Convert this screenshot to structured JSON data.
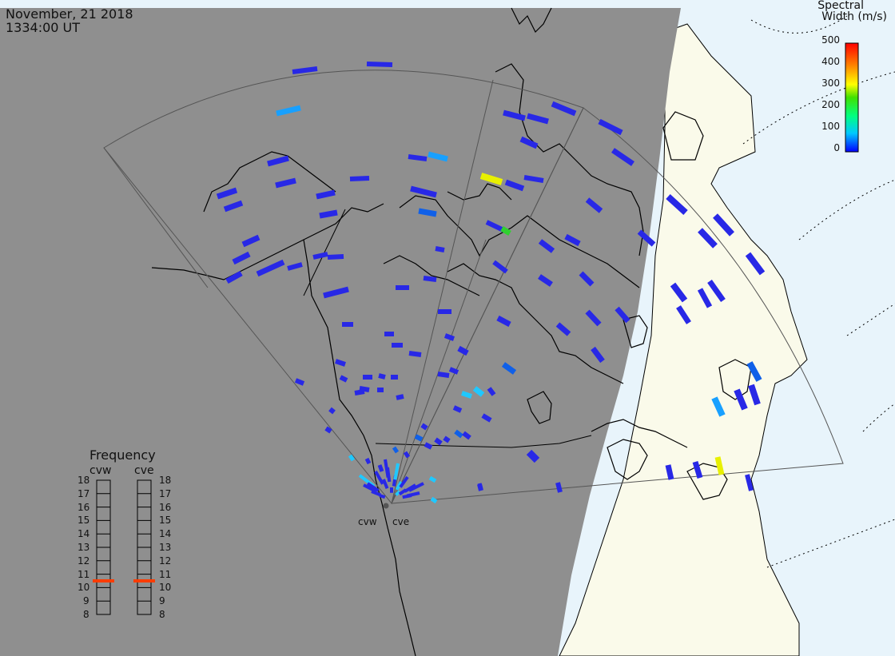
{
  "header": {
    "date": "November, 21 2018",
    "time": "1334:00 UT"
  },
  "colorbar": {
    "title_line1": "Spectral",
    "title_line2": "Width (m/s)",
    "ticks": [
      "500",
      "400",
      "300",
      "200",
      "100",
      "0"
    ],
    "colors": [
      "#ff0000",
      "#ff8000",
      "#ffff00",
      "#00d000",
      "#00c8ff",
      "#0000ff"
    ]
  },
  "frequency_panel": {
    "title": "Frequency",
    "radars": [
      {
        "name": "cvw",
        "value_mhz": 10.5
      },
      {
        "name": "cve",
        "value_mhz": 10.5
      }
    ],
    "scale": [
      "18",
      "17",
      "16",
      "15",
      "14",
      "13",
      "12",
      "11",
      "10",
      "9",
      "8"
    ]
  },
  "sites": [
    {
      "name": "cvw"
    },
    {
      "name": "cve"
    }
  ],
  "colors": {
    "night": "#8f8f8f",
    "day_land": "#fafaea",
    "day_ocean": "#e8f4fb",
    "vector_main": "#2828e6",
    "indicator": "#ff3c00"
  }
}
